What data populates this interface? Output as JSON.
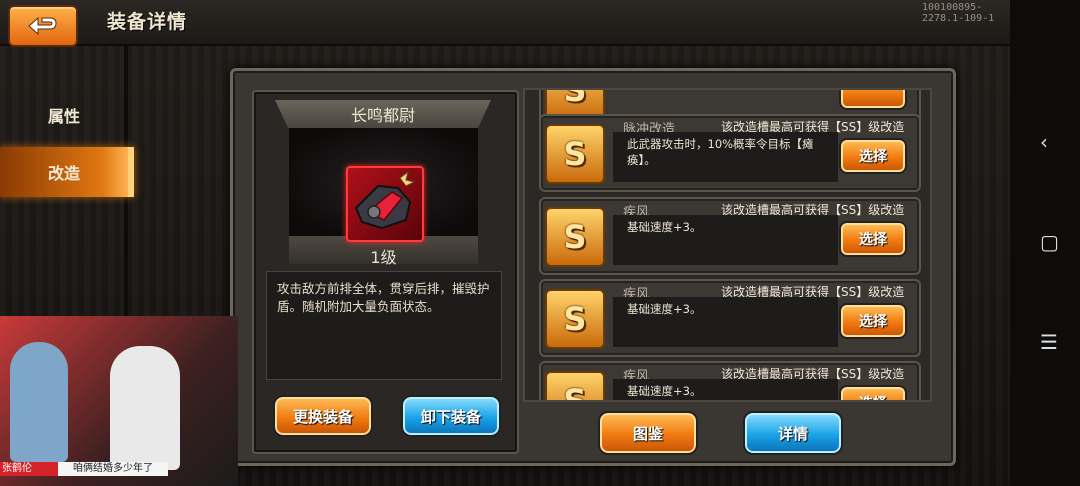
{
  "header": {
    "title": "装备详情",
    "build_id": "100100895-2278.1-109-1"
  },
  "sidebar": {
    "tabs": [
      {
        "label": "属性"
      },
      {
        "label": "改造"
      }
    ],
    "active": 1
  },
  "equipment": {
    "name": "长鸣都尉",
    "level": "1级",
    "description": "攻击敌方前排全体，贯穿后排，摧毁护盾。随机附加大量负面状态。"
  },
  "buttons": {
    "change": "更换装备",
    "unequip": "卸下装备",
    "codex": "图鉴",
    "detail": "详情"
  },
  "mod_slots": [
    {
      "grade": "S",
      "name": "脉冲改造",
      "cap": "该改造槽最高可获得【SS】级改造",
      "effect": "此武器攻击时，10%概率令目标【瘫痪】。",
      "action": "选择"
    },
    {
      "grade": "S",
      "name": "疾风",
      "cap": "该改造槽最高可获得【SS】级改造",
      "effect": "基础速度+3。",
      "action": "选择"
    },
    {
      "grade": "S",
      "name": "疾风",
      "cap": "该改造槽最高可获得【SS】级改造",
      "effect": "基础速度+3。",
      "action": "选择"
    },
    {
      "grade": "S",
      "name": "疾风",
      "cap": "该改造槽最高可获得【SS】级改造",
      "effect": "基础速度+3。",
      "action": "选择"
    }
  ],
  "stream_overlay": {
    "host": "张鹤伦",
    "caption": "咱俩结婚多少年了"
  },
  "colors": {
    "accent_orange": "#f07a10",
    "accent_blue": "#1aa2e8",
    "slot_gold": "#ffd36a"
  }
}
